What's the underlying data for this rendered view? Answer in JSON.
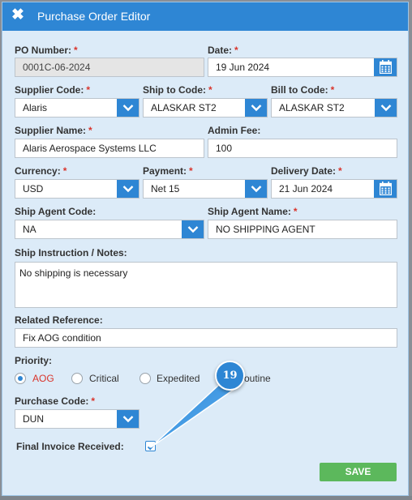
{
  "dialog": {
    "title": "Purchase Order Editor",
    "close_icon": "close-icon"
  },
  "fields": {
    "po_number": {
      "label": "PO Number:",
      "required": "*",
      "value": "0001C-06-2024"
    },
    "date": {
      "label": "Date:",
      "required": "*",
      "value": "19 Jun 2024"
    },
    "supplier_code": {
      "label": "Supplier Code:",
      "required": "*",
      "value": "Alaris"
    },
    "ship_to_code": {
      "label": "Ship to Code:",
      "required": "*",
      "value": "ALASKAR ST2"
    },
    "bill_to_code": {
      "label": "Bill to Code:",
      "required": "*",
      "value": "ALASKAR ST2"
    },
    "supplier_name": {
      "label": "Supplier Name:",
      "required": "*",
      "value": "Alaris Aerospace Systems LLC"
    },
    "admin_fee": {
      "label": "Admin Fee:",
      "value": "100"
    },
    "currency": {
      "label": "Currency:",
      "required": "*",
      "value": "USD"
    },
    "payment": {
      "label": "Payment:",
      "required": "*",
      "value": "Net 15"
    },
    "delivery_date": {
      "label": "Delivery Date:",
      "required": "*",
      "value": "21 Jun 2024"
    },
    "ship_agent_code": {
      "label": "Ship Agent Code:",
      "value": "NA"
    },
    "ship_agent_name": {
      "label": "Ship Agent Name:",
      "required": "*",
      "value": "NO SHIPPING AGENT"
    },
    "ship_instruction": {
      "label": "Ship Instruction / Notes:",
      "value": "No shipping is necessary"
    },
    "related_reference": {
      "label": "Related Reference:",
      "value": "Fix AOG condition"
    },
    "priority": {
      "label": "Priority:",
      "options": [
        "AOG",
        "Critical",
        "Expedited",
        "Routine"
      ],
      "selected": "AOG",
      "visible_routine_fragment": "outine"
    },
    "purchase_code": {
      "label": "Purchase Code:",
      "required": "*",
      "value": "DUN"
    },
    "final_invoice": {
      "label": "Final Invoice Received:",
      "checked": true
    }
  },
  "actions": {
    "save_label": "SAVE"
  },
  "annotation": {
    "step_number": "19"
  },
  "colors": {
    "accent": "#2e86d4",
    "required": "#d9342b",
    "save": "#5cb85c",
    "dialog_bg": "#dcebf8"
  }
}
